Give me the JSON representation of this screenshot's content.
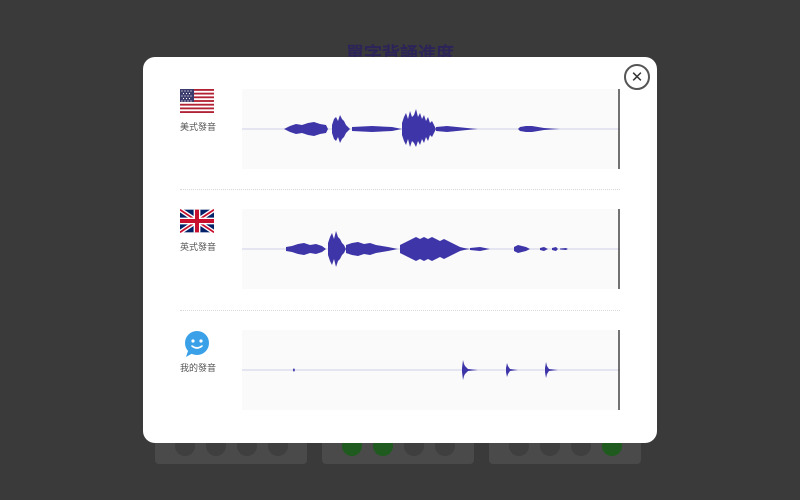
{
  "background": {
    "title": "單字背誦進度"
  },
  "modal": {
    "close_icon": "close-icon",
    "rows": [
      {
        "label": "美式發音",
        "icon": "us-flag-icon"
      },
      {
        "label": "英式發音",
        "icon": "uk-flag-icon"
      },
      {
        "label": "我的發音",
        "icon": "smiley-chat-icon"
      }
    ]
  },
  "colors": {
    "waveform": "#3d35a8",
    "baseline": "#d0d0e8",
    "playhead": "#444444"
  }
}
